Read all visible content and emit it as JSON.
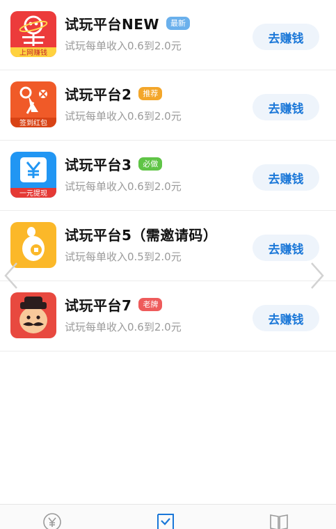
{
  "colors": {
    "button_bg": "#eef4fb",
    "button_text": "#1a77d8",
    "tab_active": "#1a77d8",
    "tab_inactive": "#9a9a9a"
  },
  "apps": [
    {
      "title": "试玩平台NEW",
      "tag": "最新",
      "tag_color": "#6ab0ec",
      "desc": "试玩每单收入0.6到2.0元",
      "button": "去赚钱",
      "icon": "planet-app-icon",
      "icon_caption": "上网赚钱"
    },
    {
      "title": "试玩平台2",
      "tag": "推荐",
      "tag_color": "#f3a62a",
      "desc": "试玩每单收入0.6到2.0元",
      "button": "去赚钱",
      "icon": "scissors-app-icon",
      "icon_caption": "签到红包"
    },
    {
      "title": "试玩平台3",
      "tag": "必做",
      "tag_color": "#5fc446",
      "desc": "试玩每单收入0.6到2.0元",
      "button": "去赚钱",
      "icon": "yuan-app-icon",
      "icon_caption": "一元提现"
    },
    {
      "title": "试玩平台5（需邀请码）",
      "tag": "",
      "tag_color": "",
      "desc": "试玩每单收入0.5到2.0元",
      "button": "去赚钱",
      "icon": "gourd-coin-app-icon",
      "icon_caption": ""
    },
    {
      "title": "试玩平台7",
      "tag": "老牌",
      "tag_color": "#ee5b5b",
      "desc": "试玩每单收入0.6到2.0元",
      "button": "去赚钱",
      "icon": "mustache-man-app-icon",
      "icon_caption": ""
    }
  ],
  "nav_arrows": [
    "chevron-left-icon",
    "chevron-right-icon"
  ],
  "tabbar": {
    "tabs": [
      {
        "icon": "yuan-coin-icon",
        "active": false
      },
      {
        "icon": "task-check-icon",
        "active": true
      },
      {
        "icon": "book-icon",
        "active": false
      }
    ]
  }
}
